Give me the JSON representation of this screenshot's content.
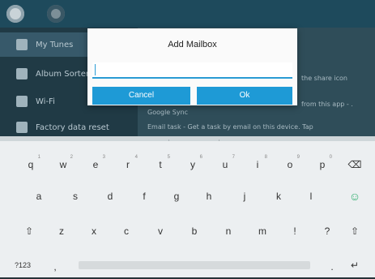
{
  "appbar": {
    "icons": [
      "settings-gear-icon",
      "gear-icon"
    ]
  },
  "drawer": {
    "items": [
      {
        "label": "My Tunes",
        "icon": "music-icon"
      },
      {
        "label": "Album Sorter",
        "icon": "album-icon"
      },
      {
        "label": "Wi-Fi",
        "icon": "wifi-icon"
      },
      {
        "label": "Factory data reset",
        "icon": "reset-icon"
      }
    ]
  },
  "background": {
    "line1": "Google Sync",
    "line2": "Email task - Get a task by email on this device. Tap",
    "line3": "the share icon",
    "line4": "from this app - ."
  },
  "dialog": {
    "title": "Add Mailbox",
    "input_value": "",
    "cancel_label": "Cancel",
    "ok_label": "Ok"
  },
  "keyboard": {
    "row1": [
      {
        "k": "q",
        "h": "1"
      },
      {
        "k": "w",
        "h": "2"
      },
      {
        "k": "e",
        "h": "3"
      },
      {
        "k": "r",
        "h": "4"
      },
      {
        "k": "t",
        "h": "5"
      },
      {
        "k": "y",
        "h": "6"
      },
      {
        "k": "u",
        "h": "7"
      },
      {
        "k": "i",
        "h": "8"
      },
      {
        "k": "o",
        "h": "9"
      },
      {
        "k": "p",
        "h": "0"
      },
      {
        "k": "⌫",
        "h": ""
      }
    ],
    "row2": [
      "a",
      "s",
      "d",
      "f",
      "g",
      "h",
      "j",
      "k",
      "l",
      "☺"
    ],
    "row3": [
      "⇧",
      "z",
      "x",
      "c",
      "v",
      "b",
      "n",
      "m",
      "!",
      "?",
      "⇧"
    ],
    "row4": {
      "left": "?123",
      "comma": ",",
      "period": ".",
      "enter": "↵"
    }
  }
}
